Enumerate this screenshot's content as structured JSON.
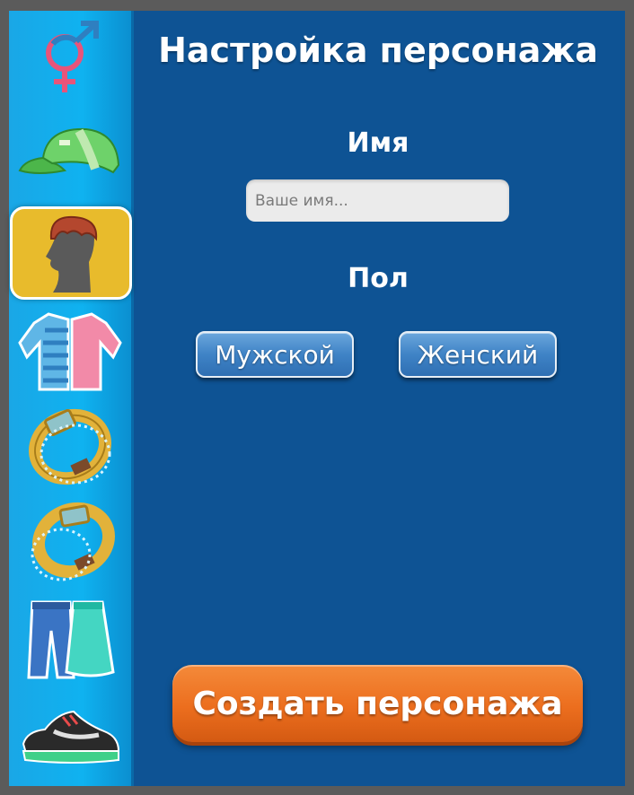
{
  "header": {
    "title": "Настройка персонажа"
  },
  "sidebar": {
    "items": [
      {
        "name": "gender-icon"
      },
      {
        "name": "cap-icon"
      },
      {
        "name": "hair-icon",
        "active": true
      },
      {
        "name": "shirt-icon"
      },
      {
        "name": "bracelet-icon"
      },
      {
        "name": "bracelet-alt-icon"
      },
      {
        "name": "pants-skirt-icon"
      },
      {
        "name": "sneaker-icon"
      }
    ],
    "colors": {
      "background": "#0fb2f0",
      "active": "#e8bb2c"
    }
  },
  "form": {
    "name_label": "Имя",
    "name_placeholder": "Ваше имя...",
    "name_value": "",
    "gender_label": "Пол",
    "male_label": "Мужской",
    "female_label": "Женский"
  },
  "actions": {
    "create_label": "Создать персонажа"
  },
  "colors": {
    "panel": "#0e5394",
    "button_blue": "#3f83c6",
    "button_orange": "#ec6e1e"
  }
}
